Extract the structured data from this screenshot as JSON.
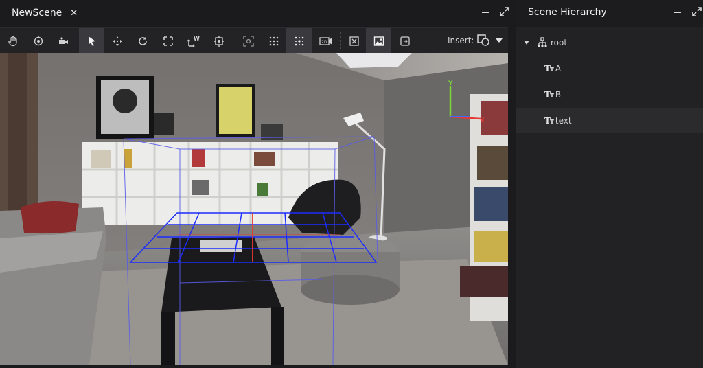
{
  "scene": {
    "tab_label": "NewScene",
    "close_icon": "close-icon"
  },
  "toolbar": {
    "tools": [
      {
        "name": "hand-icon",
        "active": false
      },
      {
        "name": "orbit-icon",
        "active": false
      },
      {
        "name": "camera-dolly-icon",
        "active": false
      },
      {
        "name": "select-arrow-icon",
        "active": true
      },
      {
        "name": "move-icon",
        "active": false
      },
      {
        "name": "rotate-icon",
        "active": false
      },
      {
        "name": "scale-icon",
        "active": false
      },
      {
        "name": "world-transform-icon",
        "active": false
      },
      {
        "name": "frame-selection-icon",
        "active": false
      },
      {
        "name": "focus-icon",
        "active": false
      },
      {
        "name": "grid-icon",
        "active": false
      },
      {
        "name": "snap-grid-icon",
        "active": true
      },
      {
        "name": "2d-3d-camera-icon",
        "active": false
      },
      {
        "name": "bounding-box-icon",
        "active": false
      },
      {
        "name": "background-image-icon",
        "active": true
      },
      {
        "name": "exit-icon",
        "active": false
      }
    ],
    "insert_label": "Insert:",
    "insert_icon": "insert-shape-icon"
  },
  "axis_gizmo": {
    "y_label": "Y",
    "x_label": "X",
    "colors": {
      "x": "#e53935",
      "y": "#7cd43a",
      "z": "#3b6bff"
    }
  },
  "hierarchy": {
    "title": "Scene Hierarchy",
    "root": {
      "label": "root",
      "icon": "hierarchy-icon",
      "expanded": true
    },
    "items": [
      {
        "label": "A",
        "icon": "text-icon",
        "selected": false
      },
      {
        "label": "B",
        "icon": "text-icon",
        "selected": false
      },
      {
        "label": "text",
        "icon": "text-icon",
        "selected": true
      }
    ]
  }
}
